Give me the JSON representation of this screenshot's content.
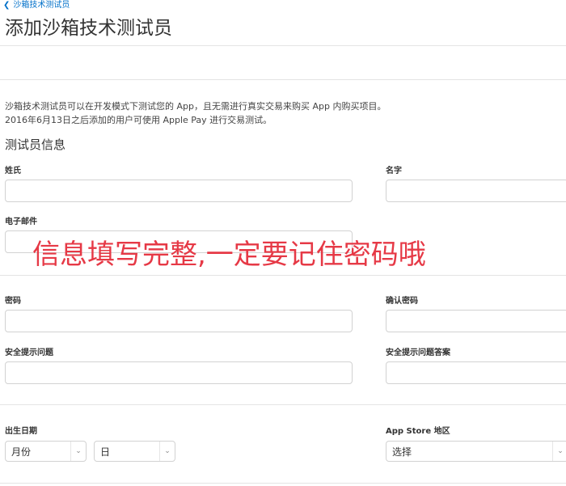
{
  "breadcrumb": {
    "back_label": "沙箱技术测试员"
  },
  "page": {
    "title": "添加沙箱技术测试员",
    "intro_line1": "沙箱技术测试员可以在开发模式下测试您的 App，且无需进行真实交易来购买 App 内购买项目。",
    "intro_line2": "2016年6月13日之后添加的用户可使用 Apple Pay 进行交易测试。"
  },
  "tester_info": {
    "section_title": "测试员信息",
    "last_name_label": "姓氏",
    "first_name_label": "名字",
    "email_label": "电子邮件",
    "password_label": "密码",
    "confirm_password_label": "确认密码",
    "security_question_label": "安全提示问题",
    "security_answer_label": "安全提示问题答案",
    "birth_date_label": "出生日期",
    "month_value": "月份",
    "day_value": "日",
    "region_label": "App Store 地区",
    "region_value": "选择"
  },
  "annotation": {
    "text": "信息填写完整,一定要记住密码哦",
    "color": "#e63946"
  },
  "colors": {
    "link": "#0070c9",
    "border": "#d2d2d2",
    "divider": "#e4e4e4"
  }
}
